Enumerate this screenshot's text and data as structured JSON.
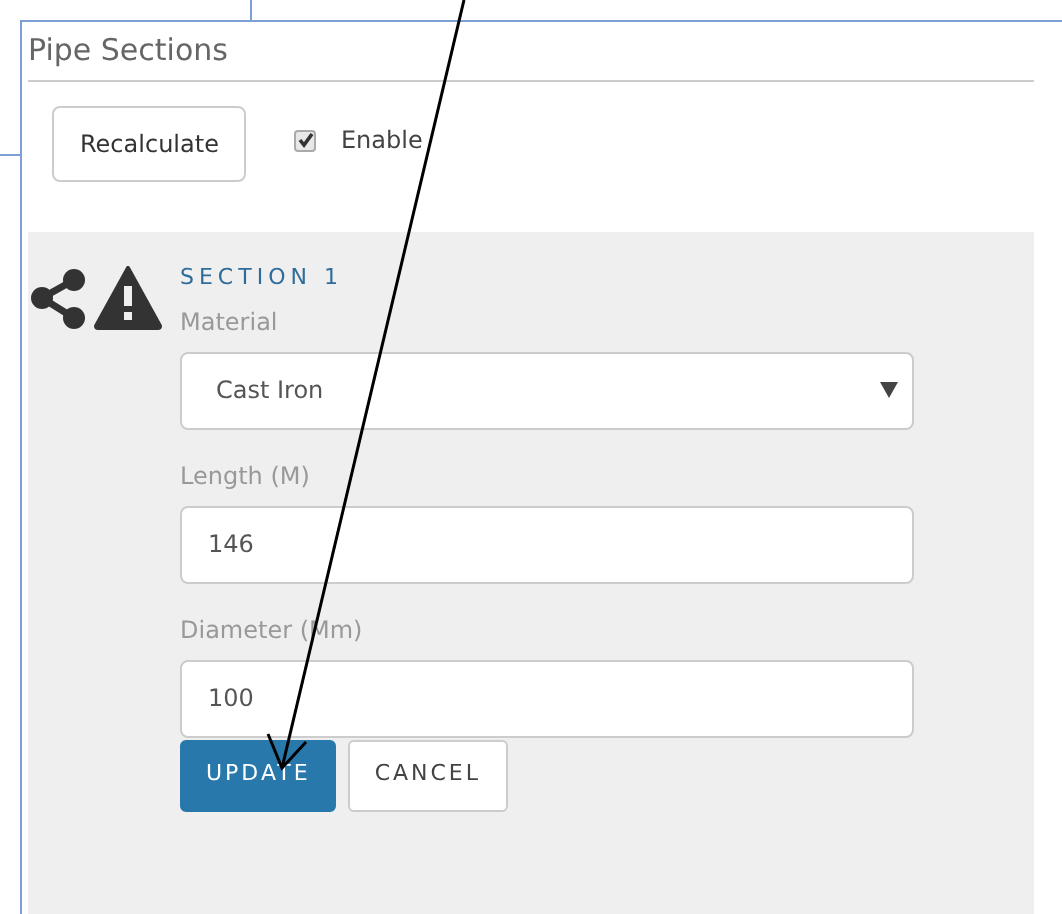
{
  "panel": {
    "title": "Pipe Sections"
  },
  "toolbar": {
    "button": "Recalculate",
    "checkbox": {
      "label": "Enable",
      "checked": true
    }
  },
  "section": {
    "title": "SECTION 1",
    "warning": true,
    "fields": [
      {
        "kind": "select",
        "label": "Material",
        "value": "Cast Iron"
      },
      {
        "kind": "text",
        "label": "Length (M)",
        "value": "146"
      },
      {
        "kind": "text",
        "label": "Diameter (Mm)",
        "value": "100"
      }
    ],
    "buttons": [
      {
        "label": "UPDATE",
        "kind": "primary"
      },
      {
        "label": "CANCEL",
        "kind": "secondary"
      }
    ]
  }
}
